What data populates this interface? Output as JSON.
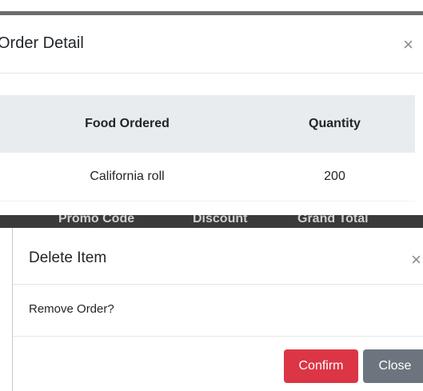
{
  "order_modal": {
    "title": "Order Detail",
    "close_glyph": "×",
    "table": {
      "headers": [
        "Food Ordered",
        "Quantity"
      ],
      "rows": [
        [
          "California roll",
          "200"
        ]
      ]
    }
  },
  "background_table": {
    "headers": [
      "Promo Code",
      "Discount",
      "Grand Total"
    ]
  },
  "delete_modal": {
    "title": "Delete Item",
    "close_glyph": "×",
    "body": "Remove Order?",
    "confirm_label": "Confirm",
    "close_label": "Close"
  },
  "colors": {
    "confirm": "#dc3545",
    "close": "#6c757d",
    "header_bg": "#e9ecef"
  }
}
